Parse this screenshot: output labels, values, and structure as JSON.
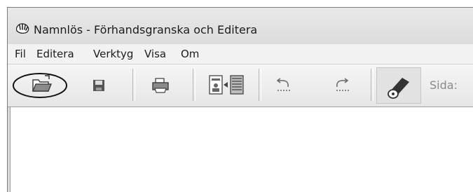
{
  "window": {
    "title": "Namnlös - Förhandsgranska och Editera"
  },
  "menubar": {
    "items": [
      "Fil",
      "Editera",
      "Verktyg",
      "Visa",
      "Om"
    ]
  },
  "toolbar": {
    "buttons": [
      {
        "icon": "open-folder-icon",
        "highlighted": true
      },
      {
        "icon": "save-disk-icon"
      },
      {
        "icon": "printer-icon"
      },
      {
        "icon": "page-layout-icon"
      },
      {
        "icon": "undo-icon"
      },
      {
        "icon": "redo-icon"
      },
      {
        "icon": "tape-roll-icon",
        "pressed": true
      }
    ],
    "page_label": "Sida:"
  },
  "colors": {
    "highlight_ellipse": "#111111",
    "toolbar_icon": "#555555"
  }
}
